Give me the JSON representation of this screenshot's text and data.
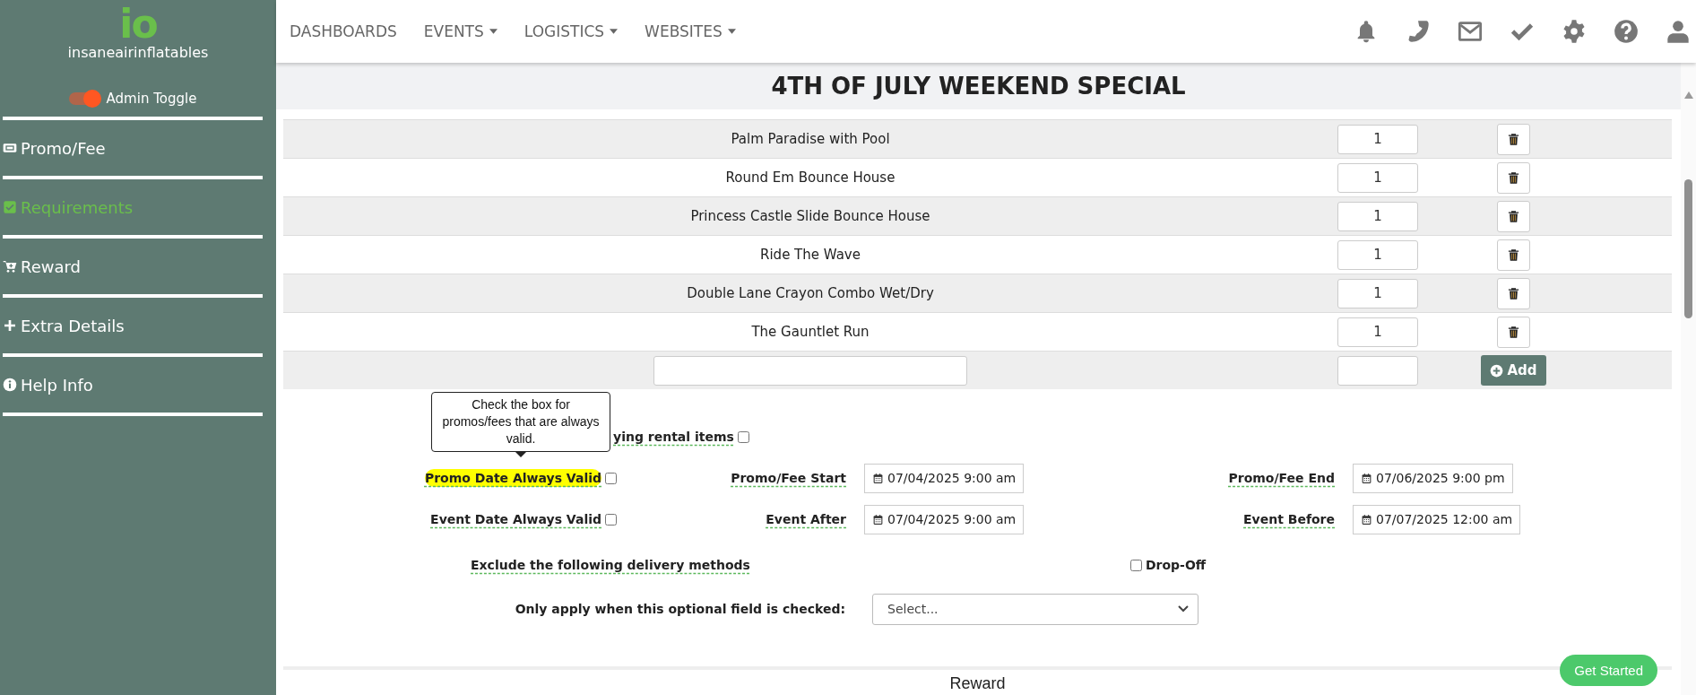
{
  "sidebar": {
    "logo_mark": "io",
    "brand": "insaneairinflatables",
    "admin_toggle": {
      "label": "Admin Toggle",
      "on": true
    },
    "items": [
      {
        "label": "Promo/Fee",
        "selected": false
      },
      {
        "label": "Requirements",
        "selected": true
      },
      {
        "label": "Reward",
        "selected": false
      },
      {
        "label": "Extra Details",
        "selected": false
      },
      {
        "label": "Help Info",
        "selected": false
      }
    ]
  },
  "nav": {
    "items": [
      {
        "label": "DASHBOARDS",
        "dropdown": false
      },
      {
        "label": "EVENTS",
        "dropdown": true
      },
      {
        "label": "LOGISTICS",
        "dropdown": true
      },
      {
        "label": "WEBSITES",
        "dropdown": true
      }
    ]
  },
  "page_title": "4TH OF JULY WEEKEND SPECIAL",
  "items_table": {
    "rows": [
      {
        "name": "Palm Paradise with Pool",
        "quantity": "1"
      },
      {
        "name": "Round Em Bounce House",
        "quantity": "1"
      },
      {
        "name": "Princess Castle Slide Bounce House",
        "quantity": "1"
      },
      {
        "name": "Ride The Wave",
        "quantity": "1"
      },
      {
        "name": "Double Lane Crayon Combo Wet/Dry",
        "quantity": "1"
      },
      {
        "name": "The Gauntlet Run",
        "quantity": "1"
      }
    ],
    "add_button": "Add"
  },
  "tooltip": "Check the box for promos/fees that are always valid.",
  "form": {
    "exclude_items": {
      "label": "ying rental items",
      "checked": false
    },
    "promo_always_valid": {
      "label": "Promo Date Always Valid",
      "checked": false,
      "highlighted": true
    },
    "promo_start": {
      "label": "Promo/Fee Start",
      "value": "07/04/2025 9:00 am"
    },
    "promo_end": {
      "label": "Promo/Fee End",
      "value": "07/06/2025 9:00 pm"
    },
    "event_always_valid": {
      "label": "Event Date Always Valid",
      "checked": false,
      "highlighted": false
    },
    "event_after": {
      "label": "Event After",
      "value": "07/04/2025 9:00 am"
    },
    "event_before": {
      "label": "Event Before",
      "value": "07/07/2025 12:00 am"
    },
    "delivery": {
      "label": "Exclude the following delivery methods",
      "methods": [
        {
          "label": "Drop-Off",
          "checked": false
        }
      ]
    },
    "optional_field": {
      "label": "Only apply when this optional field is checked:",
      "value": "Select..."
    }
  },
  "reward_heading": "Reward",
  "get_started": "Get Started"
}
